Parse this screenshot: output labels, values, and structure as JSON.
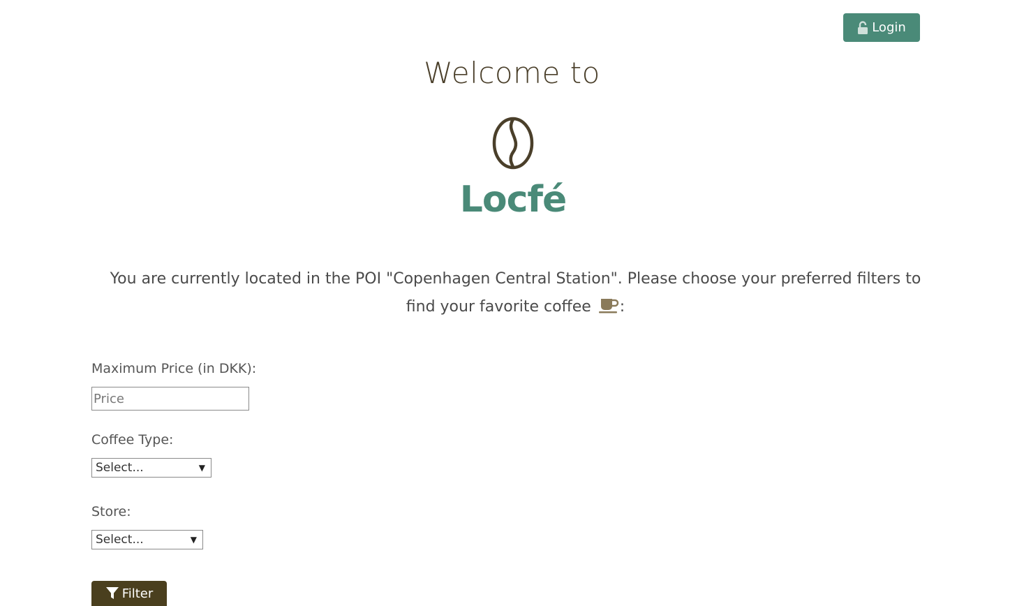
{
  "header": {
    "login_label": "Login",
    "login_icon": "unlock-icon"
  },
  "hero": {
    "welcome": "Welcome to",
    "logo_text": "Locfé",
    "logo_icon": "coffee-bean-icon"
  },
  "intro": {
    "text": "You are currently located in the POI \"Copenhagen Central Station\". Please choose your preferred filters to find your favorite coffee",
    "trailing": ":",
    "icon": "coffee-cup-icon"
  },
  "filters": {
    "price_label": "Maximum Price (in DKK):",
    "price_placeholder": "Price",
    "price_value": "",
    "coffee_type_label": "Coffee Type:",
    "coffee_type_value": "Select...",
    "store_label": "Store:",
    "store_value": "Select...",
    "filter_button_label": "Filter",
    "filter_icon": "funnel-icon"
  },
  "colors": {
    "accent_green": "#4a8a78",
    "dark_brown": "#4a3f1e",
    "bean_brown": "#4a3f2a"
  }
}
